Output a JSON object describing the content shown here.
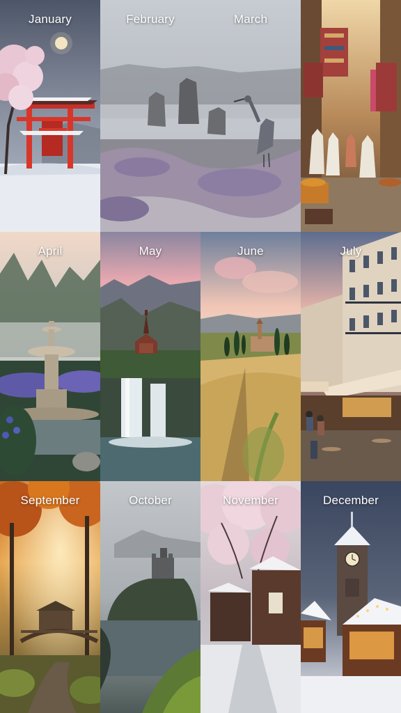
{
  "months": {
    "january": "January",
    "february": "February",
    "march": "March",
    "april": "April",
    "may": "May",
    "june": "June",
    "july": "July",
    "september": "September",
    "october": "October",
    "november": "November",
    "december": "December"
  },
  "scenes": [
    {
      "month": "January",
      "scene": "torii-gate-snow-cherry-blossom-full-moon"
    },
    {
      "month": "February",
      "scene": "misty-standing-stones-heron-heather"
    },
    {
      "month": "March",
      "scene": "market-alley-textiles-robed-figures"
    },
    {
      "month": "April",
      "scene": "misty-forest-fountain-bluebells"
    },
    {
      "month": "May",
      "scene": "mountain-chapel-waterfall"
    },
    {
      "month": "June",
      "scene": "wheat-field-cypress-hill-town"
    },
    {
      "month": "July",
      "scene": "parisian-street-cafe-evening"
    },
    {
      "month": "September",
      "scene": "autumn-forest-bridge-cabin"
    },
    {
      "month": "October",
      "scene": "misty-castle-on-sea-cliff"
    },
    {
      "month": "November",
      "scene": "snowy-village-cherry-blossom"
    },
    {
      "month": "December",
      "scene": "christmas-market-clock-tower-snow"
    }
  ],
  "colors": {
    "background": "#1a1a1f",
    "label": "#ffffff",
    "torii_red": "#d8362a",
    "autumn_orange": "#d9771f",
    "dusk_pink": "#e9a9b0"
  }
}
